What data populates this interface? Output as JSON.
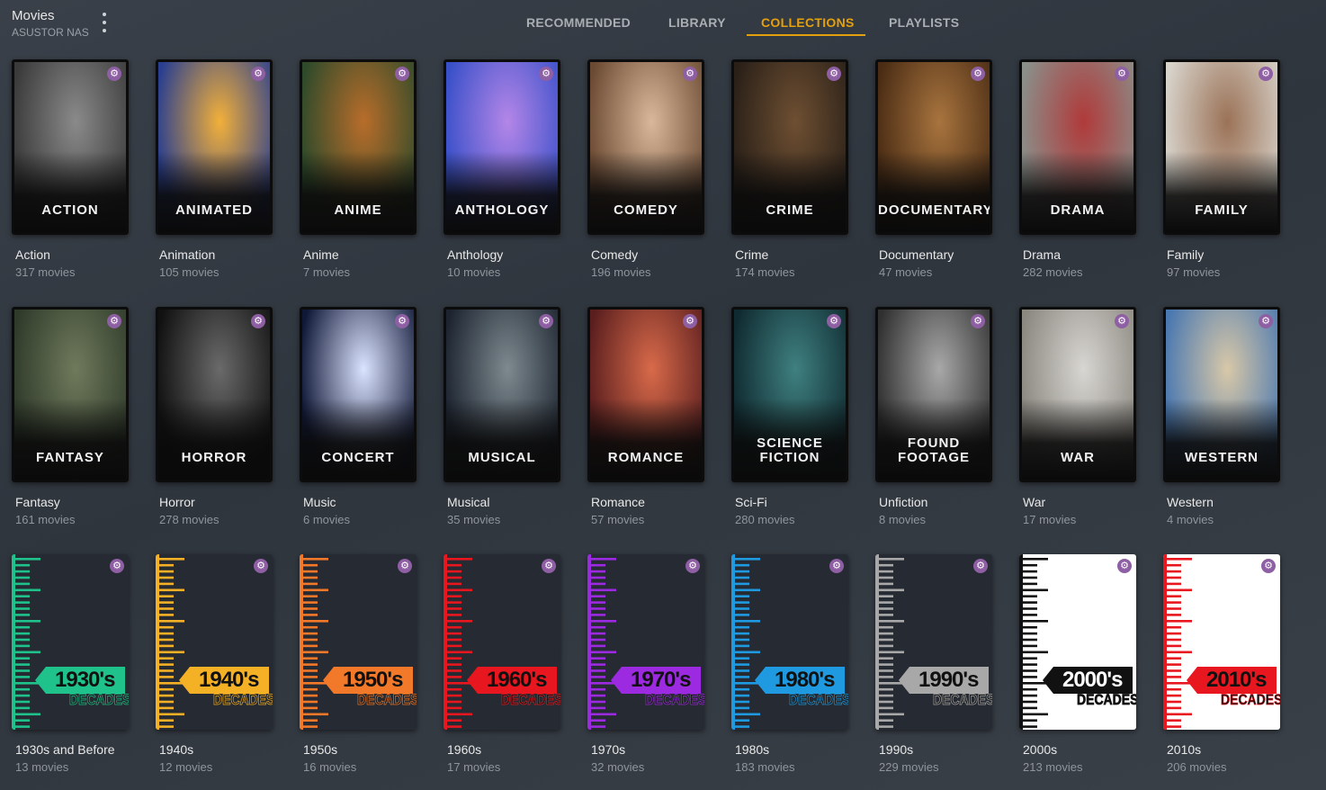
{
  "server": {
    "title": "Movies",
    "subtitle": "ASUSTOR NAS"
  },
  "tabs": [
    {
      "label": "RECOMMENDED",
      "active": false
    },
    {
      "label": "LIBRARY",
      "active": false
    },
    {
      "label": "COLLECTIONS",
      "active": true
    },
    {
      "label": "PLAYLISTS",
      "active": false
    }
  ],
  "accent_color": "#e5a00d",
  "badge_icon": "gear-icon",
  "collections": [
    {
      "poster_text": "ACTION",
      "name": "Action",
      "count": "317 movies",
      "colors": [
        "#3a3a3a",
        "#8a8a8a"
      ]
    },
    {
      "poster_text": "ANIMATED",
      "name": "Animation",
      "count": "105 movies",
      "colors": [
        "#2a3f8f",
        "#f2b03a"
      ]
    },
    {
      "poster_text": "ANIME",
      "name": "Anime",
      "count": "7 movies",
      "colors": [
        "#2e4a2a",
        "#b86d2a"
      ]
    },
    {
      "poster_text": "ANTHOLOGY",
      "name": "Anthology",
      "count": "10 movies",
      "colors": [
        "#3950c9",
        "#b486e8"
      ]
    },
    {
      "poster_text": "COMEDY",
      "name": "Comedy",
      "count": "196 movies",
      "colors": [
        "#6b4a33",
        "#d9b89a"
      ]
    },
    {
      "poster_text": "CRIME",
      "name": "Crime",
      "count": "174 movies",
      "colors": [
        "#2a2018",
        "#6e4f32"
      ]
    },
    {
      "poster_text": "DOCUMENTARY",
      "name": "Documentary",
      "count": "47 movies",
      "colors": [
        "#4a2c14",
        "#a8743e"
      ]
    },
    {
      "poster_text": "DRAMA",
      "name": "Drama",
      "count": "282 movies",
      "colors": [
        "#8a8f8a",
        "#b03a3a"
      ]
    },
    {
      "poster_text": "FAMILY",
      "name": "Family",
      "count": "97 movies",
      "colors": [
        "#d8d4cc",
        "#9b7257"
      ]
    },
    {
      "poster_text": "FANTASY",
      "name": "Fantasy",
      "count": "161 movies",
      "colors": [
        "#2f3a2a",
        "#6f7a5c"
      ]
    },
    {
      "poster_text": "HORROR",
      "name": "Horror",
      "count": "278 movies",
      "colors": [
        "#111111",
        "#6a6a6a"
      ]
    },
    {
      "poster_text": "CONCERT",
      "name": "Music",
      "count": "6 movies",
      "colors": [
        "#101838",
        "#dbe4ff"
      ]
    },
    {
      "poster_text": "MUSICAL",
      "name": "Musical",
      "count": "35 movies",
      "colors": [
        "#1d2430",
        "#7d8a8f"
      ]
    },
    {
      "poster_text": "ROMANCE",
      "name": "Romance",
      "count": "57 movies",
      "colors": [
        "#5a1e1e",
        "#d86a4a"
      ]
    },
    {
      "poster_text": "SCIENCE\nFICTION",
      "name": "Sci-Fi",
      "count": "280 movies",
      "colors": [
        "#0f2a30",
        "#3f8080"
      ]
    },
    {
      "poster_text": "FOUND\nFOOTAGE",
      "name": "Unfiction",
      "count": "8 movies",
      "colors": [
        "#303030",
        "#a8a8a8"
      ]
    },
    {
      "poster_text": "WAR",
      "name": "War",
      "count": "17 movies",
      "colors": [
        "#8b8880",
        "#d8d6d2"
      ]
    },
    {
      "poster_text": "WESTERN",
      "name": "Western",
      "count": "4 movies",
      "colors": [
        "#4a78b0",
        "#d8c8a8"
      ]
    },
    {
      "decade": "1930's",
      "decade_word": "DECADES",
      "name": "1930s and Before",
      "count": "13 movies",
      "colors": [
        "#1fc28a",
        "#262b33"
      ]
    },
    {
      "decade": "1940's",
      "decade_word": "DECADES",
      "name": "1940s",
      "count": "12 movies",
      "colors": [
        "#f5b125",
        "#262b33"
      ]
    },
    {
      "decade": "1950's",
      "decade_word": "DECADES",
      "name": "1950s",
      "count": "16 movies",
      "colors": [
        "#f2782a",
        "#262b33"
      ]
    },
    {
      "decade": "1960's",
      "decade_word": "DECADES",
      "name": "1960s",
      "count": "17 movies",
      "colors": [
        "#e8161e",
        "#262b33"
      ]
    },
    {
      "decade": "1970's",
      "decade_word": "DECADES",
      "name": "1970s",
      "count": "32 movies",
      "colors": [
        "#9b2ae0",
        "#262b33"
      ]
    },
    {
      "decade": "1980's",
      "decade_word": "DECADES",
      "name": "1980s",
      "count": "183 movies",
      "colors": [
        "#1f9ae0",
        "#262b33"
      ]
    },
    {
      "decade": "1990's",
      "decade_word": "DECADES",
      "name": "1990s",
      "count": "229 movies",
      "colors": [
        "#a8a8a8",
        "#262b33"
      ]
    },
    {
      "decade": "2000's",
      "decade_word": "DECADES",
      "name": "2000s",
      "count": "213 movies",
      "colors": [
        "#111111",
        "#ffffff"
      ]
    },
    {
      "decade": "2010's",
      "decade_word": "DECADES",
      "name": "2010s",
      "count": "206 movies",
      "colors": [
        "#e8161e",
        "#ffffff"
      ]
    }
  ]
}
